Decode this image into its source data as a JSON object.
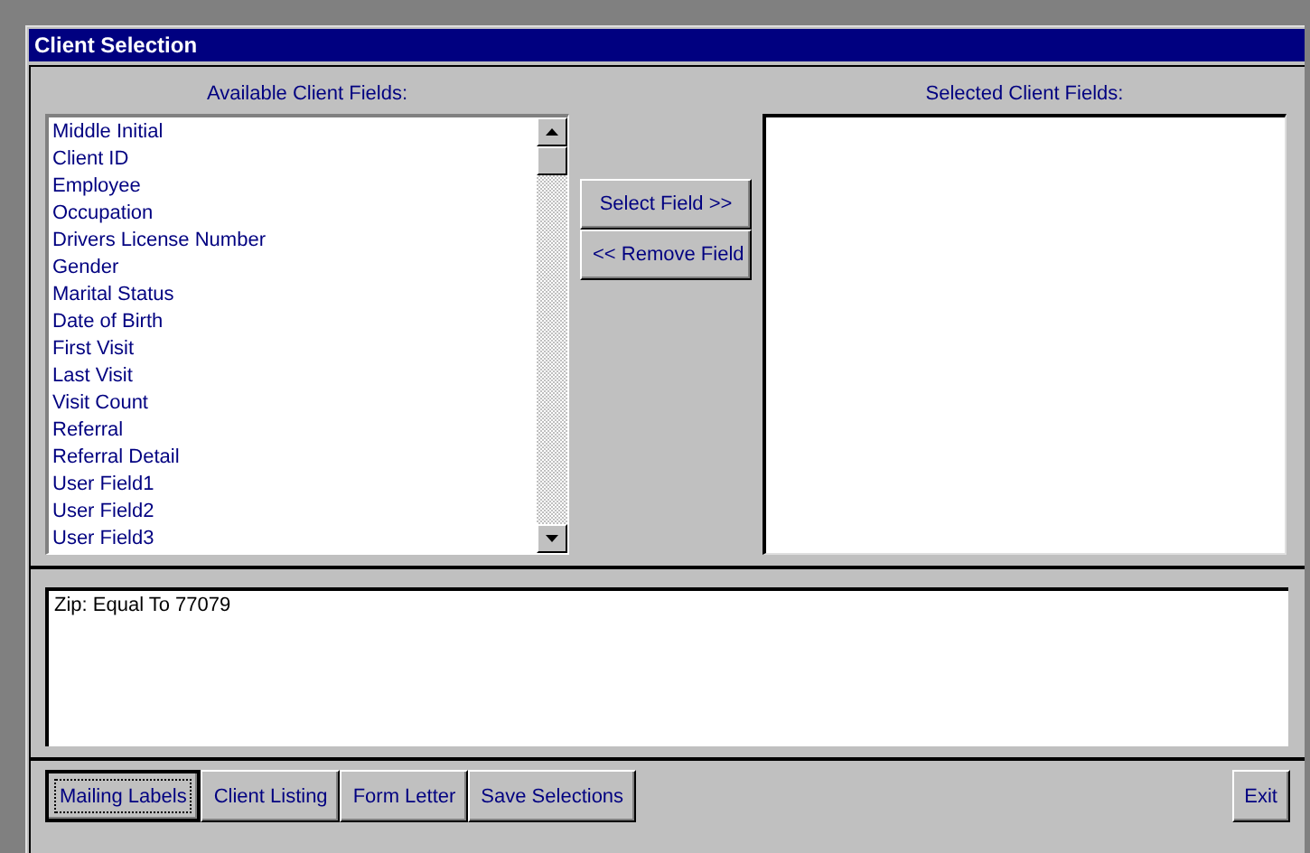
{
  "window": {
    "title": "Client Selection"
  },
  "available_fields": {
    "label": "Available Client Fields:",
    "items": [
      {
        "text": "Middle Initial"
      },
      {
        "text": "Client ID"
      },
      {
        "text": "Employee"
      },
      {
        "text": "Occupation"
      },
      {
        "text": "Drivers License Number"
      },
      {
        "text": "Gender"
      },
      {
        "text": "Marital Status"
      },
      {
        "text": "Date of Birth"
      },
      {
        "text": "First Visit"
      },
      {
        "text": "Last Visit"
      },
      {
        "text": "Visit Count"
      },
      {
        "text": "Referral"
      },
      {
        "text": "Referral Detail"
      },
      {
        "text": "User Field1"
      },
      {
        "text": "User Field2"
      },
      {
        "text": "User Field3"
      }
    ]
  },
  "move_buttons": [
    {
      "label": "Select Field >>"
    },
    {
      "label": "<< Remove Field"
    }
  ],
  "selected_fields": {
    "label": "Selected Client Fields:"
  },
  "criteria": {
    "value": "Zip: Equal To 77079"
  },
  "actions": [
    {
      "label": "Mailing Labels",
      "focused": true
    },
    {
      "label": "Client Listing",
      "focused": false
    },
    {
      "label": "Form Letter",
      "focused": false
    },
    {
      "label": "Save Selections",
      "focused": false
    }
  ],
  "exit_button": {
    "label": "Exit"
  }
}
